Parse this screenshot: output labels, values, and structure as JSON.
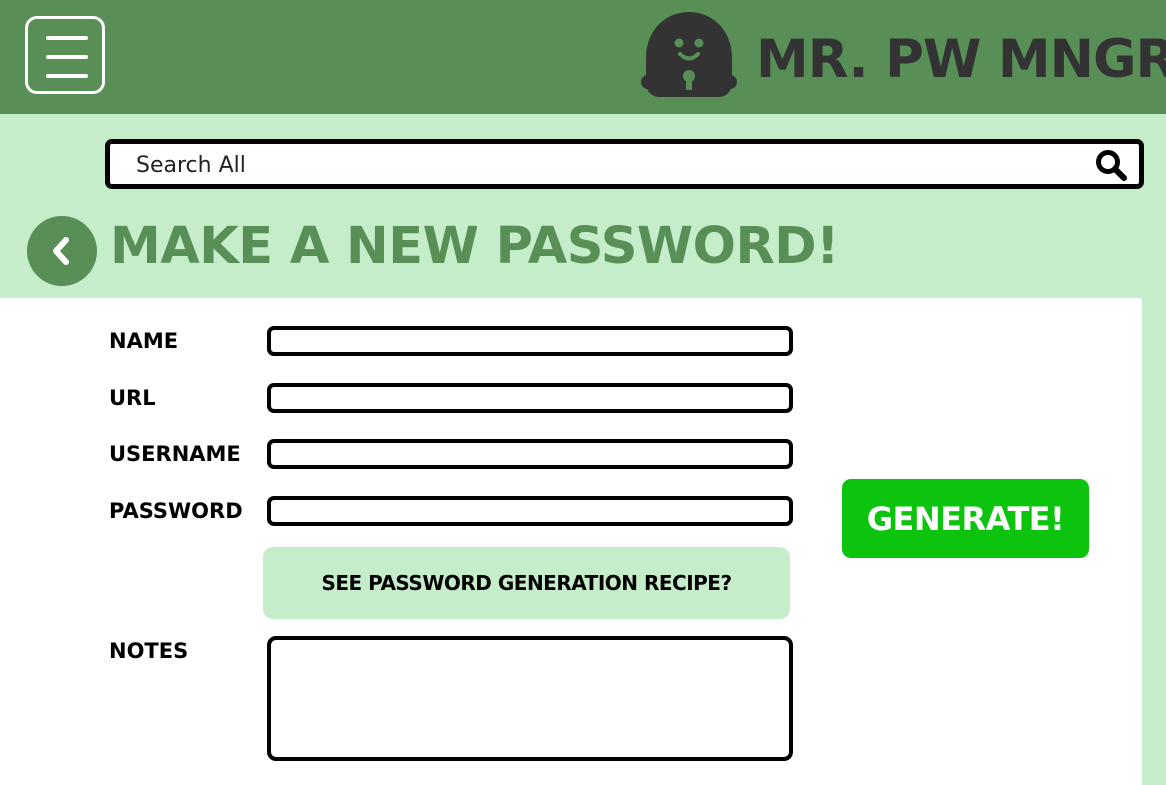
{
  "header": {
    "app_title": "MR. PW MNGR",
    "menu_icon": "hamburger-menu-icon",
    "logo_icon": "padlock-mascot-logo-icon"
  },
  "search": {
    "placeholder": "Search All",
    "icon": "search-icon"
  },
  "page": {
    "title": "MAKE A NEW PASSWORD!",
    "back_icon": "chevron-left-icon"
  },
  "form": {
    "name_label": "NAME",
    "url_label": "URL",
    "username_label": "USERNAME",
    "password_label": "PASSWORD",
    "notes_label": "NOTES",
    "name_value": "",
    "url_value": "",
    "username_value": "",
    "password_value": "",
    "notes_value": "",
    "recipe_button": "SEE PASSWORD GENERATION RECIPE?",
    "generate_button": "GENERATE!"
  },
  "colors": {
    "header_green": "#578f57",
    "light_green": "#c6edca",
    "generate_green": "#0cc30e",
    "logo_dark": "#333333"
  }
}
